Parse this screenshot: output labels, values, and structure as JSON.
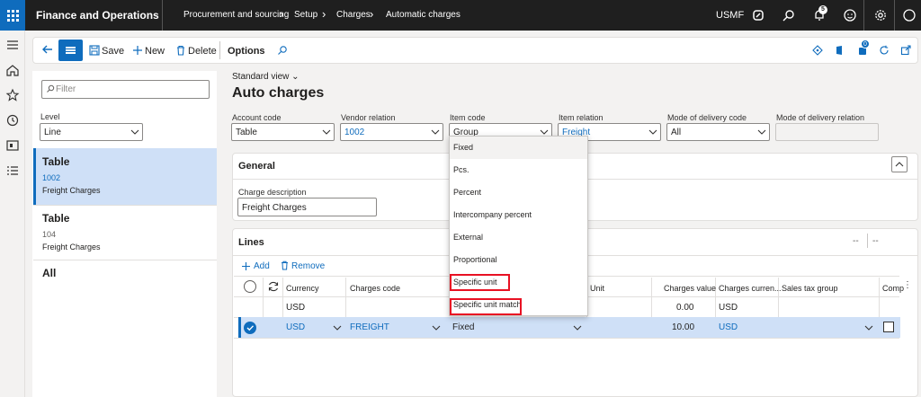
{
  "topbar": {
    "app_title": "Finance and Operations",
    "breadcrumb": [
      "Procurement and sourcing",
      "Setup",
      "Charges",
      "Automatic charges"
    ],
    "company": "USMF",
    "notification_count": "5"
  },
  "actionpane": {
    "save_label": "Save",
    "new_label": "New",
    "delete_label": "Delete",
    "options_label": "Options",
    "attach_count": "0"
  },
  "listpane": {
    "filter_placeholder": "Filter",
    "level_label": "Level",
    "level_value": "Line",
    "records": [
      {
        "title": "Table",
        "sub1": "1002",
        "sub2": "Freight Charges"
      },
      {
        "title": "Table",
        "sub1": "104",
        "sub2": "Freight Charges"
      },
      {
        "title": "All",
        "sub1": "",
        "sub2": ""
      }
    ]
  },
  "main": {
    "view_label": "Standard view",
    "page_title": "Auto charges",
    "fields": {
      "account_code_label": "Account code",
      "account_code_value": "Table",
      "vendor_relation_label": "Vendor relation",
      "vendor_relation_value": "1002",
      "item_code_label": "Item code",
      "item_code_value": "Group",
      "item_relation_label": "Item relation",
      "item_relation_value": "Freight",
      "mode_delivery_code_label": "Mode of delivery code",
      "mode_delivery_code_value": "All",
      "mode_delivery_relation_label": "Mode of delivery relation"
    },
    "general": {
      "title": "General",
      "charge_desc_label": "Charge description",
      "charge_desc_value": "Freight Charges"
    },
    "lines": {
      "title": "Lines",
      "add_label": "Add",
      "remove_label": "Remove",
      "more_a": "--",
      "more_b": "--",
      "columns": [
        "Currency",
        "Charges code",
        "Unit",
        "Charges value",
        "Charges curren...",
        "Sales tax group",
        "Comp"
      ],
      "rows": [
        {
          "currency": "USD",
          "charges_code": "",
          "category": "",
          "unit": "",
          "charges_value": "0.00",
          "charges_currency": "USD",
          "sales_tax_group": ""
        },
        {
          "currency": "USD",
          "charges_code": "FREIGHT",
          "category": "Fixed",
          "unit": "",
          "charges_value": "10.00",
          "charges_currency": "USD",
          "sales_tax_group": ""
        }
      ]
    }
  },
  "dropdown_menu": {
    "options": [
      "Fixed",
      "Pcs.",
      "Percent",
      "Intercompany percent",
      "External",
      "Proportional",
      "Specific unit",
      "Specific unit match"
    ],
    "highlighted": "Fixed",
    "outlined": [
      "Specific unit",
      "Specific unit match"
    ]
  },
  "colors": {
    "accent": "#0f6cbd",
    "topbar": "#1f1f1f",
    "selection": "#cfe0f7",
    "annotation": "#e81123"
  }
}
